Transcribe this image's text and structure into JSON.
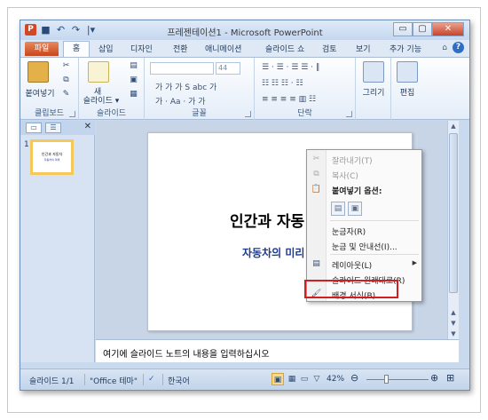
{
  "window": {
    "title": "프레젠테이션1 - Microsoft PowerPoint",
    "app_icon": "P",
    "controls": {
      "minimize": "▭",
      "maximize": "▢",
      "close": "✕"
    }
  },
  "quick_access": {
    "save": "■",
    "undo": "↶",
    "redo": "↷",
    "customize": "|▾"
  },
  "ribbon_tabs": {
    "file": "파일",
    "home": "홈",
    "insert": "삽입",
    "design": "디자인",
    "transitions": "전환",
    "animations": "애니메이션",
    "slideshow": "슬라이드 쇼",
    "review": "검토",
    "view": "보기",
    "addins": "추가 기능",
    "minimize_ribbon": "⌂",
    "help": "?"
  },
  "ribbon": {
    "clipboard": {
      "label": "클립보드",
      "paste": "붙여넣기"
    },
    "slides": {
      "label": "슬라이드",
      "new_slide_line1": "새",
      "new_slide_line2": "슬라이드 ▾"
    },
    "font": {
      "label": "글꼴",
      "font_name": "",
      "font_size": "44"
    },
    "paragraph": {
      "label": "단락"
    },
    "drawing": {
      "draw": "그리기",
      "edit": "편집"
    }
  },
  "slides_pane": {
    "slide_number": "1",
    "thumb_title": "인간과 자동차",
    "thumb_subtitle": "자동차의 미래"
  },
  "slide": {
    "title": "인간과 자동",
    "subtitle": "자동차의 미리"
  },
  "notes": {
    "placeholder": "여기에 슬라이드 노트의 내용을 입력하십시오"
  },
  "status": {
    "slide_counter": "슬라이드 1/1",
    "theme": "\"Office 테마\"",
    "language": "한국어",
    "zoom": "42%"
  },
  "context_menu": {
    "items": [
      {
        "label": "잘라내기(T)",
        "icon": "✂",
        "enabled": false
      },
      {
        "label": "복사(C)",
        "icon": "⧉",
        "enabled": false
      },
      {
        "label": "붙여넣기 옵션:",
        "icon": "📋",
        "enabled": true
      },
      {
        "label": "눈금자(R)",
        "icon": "",
        "enabled": true
      },
      {
        "label": "눈금 및 안내선(I)...",
        "icon": "",
        "enabled": true
      },
      {
        "label": "레이아웃(L)",
        "icon": "▤",
        "enabled": true
      },
      {
        "label": "슬라이드 원래대로(R)",
        "icon": "",
        "enabled": true
      },
      {
        "label": "배경 서식(B)...",
        "icon": "🖌",
        "enabled": true
      }
    ]
  },
  "colors": {
    "file_tab": "#c6471b",
    "highlight": "#d21e1e",
    "subtitle_text": "#1f3b8a"
  }
}
